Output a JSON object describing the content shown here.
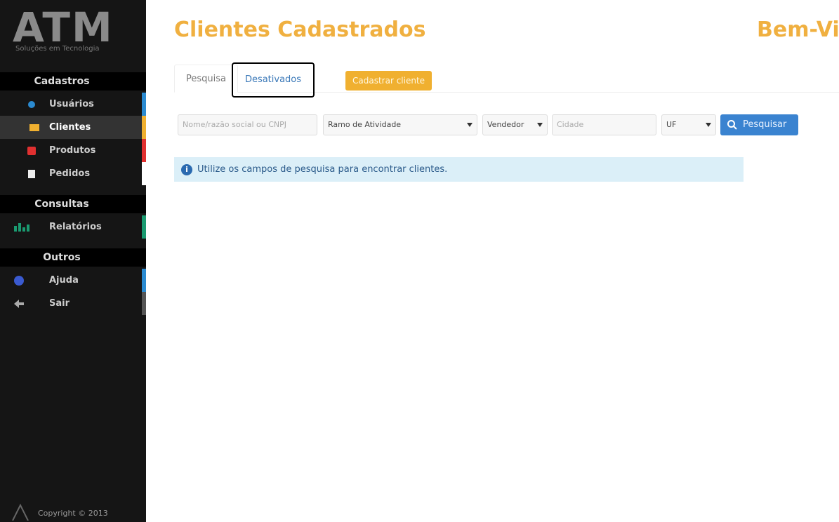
{
  "sidebar": {
    "logo": {
      "text": "ATM",
      "tagline": "Soluções em Tecnologia"
    },
    "sections": [
      {
        "title": "Cadastros"
      },
      {
        "title": "Consultas"
      },
      {
        "title": "Outros"
      }
    ],
    "items": [
      {
        "label": "Usuários",
        "icon": "user-icon",
        "color": "#2a8ad0"
      },
      {
        "label": "Clientes",
        "icon": "envelope-icon",
        "color": "#f0b030"
      },
      {
        "label": "Produtos",
        "icon": "box-icon",
        "color": "#e03030"
      },
      {
        "label": "Pedidos",
        "icon": "document-icon",
        "color": "#ffffff"
      },
      {
        "label": "Relatórios",
        "icon": "chart-icon",
        "color": "#1a9a70"
      },
      {
        "label": "Ajuda",
        "icon": "help-icon",
        "color": "#2a8ad0"
      },
      {
        "label": "Sair",
        "icon": "logout-icon",
        "color": "#555555"
      }
    ],
    "copyright": "Copyright © 2013"
  },
  "header": {
    "title": "Clientes Cadastrados",
    "welcome": "Bem-Vi"
  },
  "tabs": [
    {
      "label": "Pesquisa"
    },
    {
      "label": "Desativados"
    }
  ],
  "add_client_button": "Cadastrar cliente",
  "filters": {
    "name_placeholder": "Nome/razão social ou CNPJ",
    "activity_value": "Ramo de Atividade",
    "seller_value": "Vendedor",
    "city_placeholder": "Cidade",
    "uf_value": "UF",
    "search_label": "Pesquisar"
  },
  "info_message": "Utilize os campos de pesquisa para encontrar clientes.",
  "colors": {
    "accent": "#f0b040",
    "primary": "#3a83d0",
    "sidebar": "#151515"
  }
}
